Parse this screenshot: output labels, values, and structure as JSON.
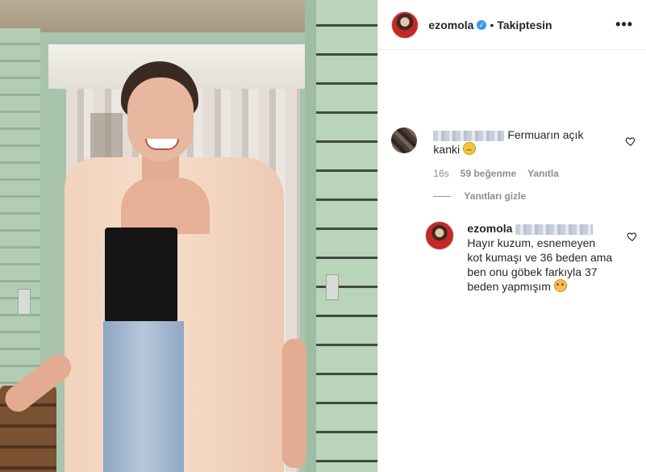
{
  "post": {
    "username": "ezomola",
    "follow_status": "Takiptesin",
    "separator": "•",
    "more_icon": "more-dots-icon"
  },
  "comment": {
    "text": "Fermuarın açık kanki",
    "emoji": "sad-face-emoji",
    "time": "16s",
    "likes": "59 beğenme",
    "reply_label": "Yanıtla",
    "hide_replies_label": "Yanıtları gizle"
  },
  "reply": {
    "username": "ezomola",
    "text": "Hayır kuzum, esnemeyen kot kumaşı ve 36 beden ama ben onu göbek farkıyla 37 beden yapmışım",
    "emoji": "smiling-heart-eyes-emoji"
  },
  "colors": {
    "verified": "#3897f0",
    "muted_text": "#8e8e8e"
  }
}
